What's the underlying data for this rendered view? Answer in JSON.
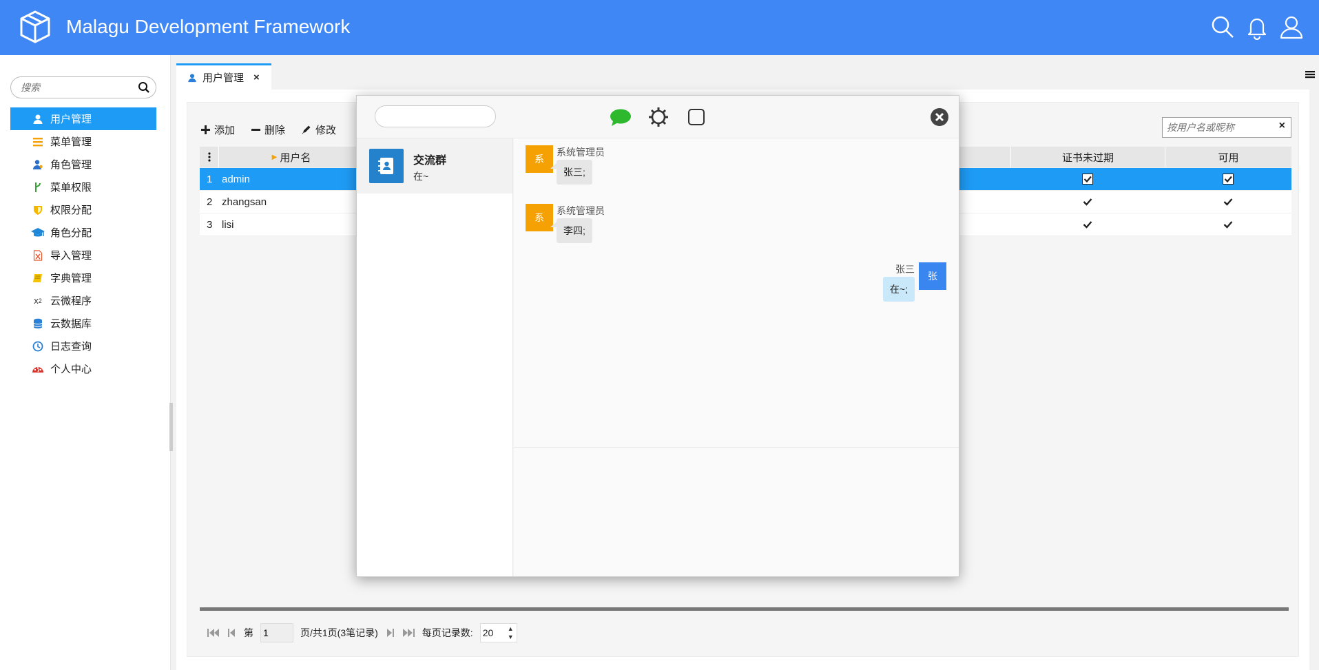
{
  "header": {
    "title": "Malagu Development Framework",
    "icons": [
      "box-logo-icon",
      "search-icon",
      "bell-icon",
      "user-icon"
    ],
    "color": "#3f87f5"
  },
  "sidebar": {
    "search_placeholder": "搜索",
    "items": [
      {
        "label": "用户管理",
        "icon": "user-icon",
        "active": true
      },
      {
        "label": "菜单管理",
        "icon": "list-icon"
      },
      {
        "label": "角色管理",
        "icon": "role-icon"
      },
      {
        "label": "菜单权限",
        "icon": "branch-icon"
      },
      {
        "label": "权限分配",
        "icon": "shield-icon"
      },
      {
        "label": "角色分配",
        "icon": "graduation-cap-icon"
      },
      {
        "label": "导入管理",
        "icon": "excel-file-icon"
      },
      {
        "label": "字典管理",
        "icon": "book-icon"
      },
      {
        "label": "云微程序",
        "icon": "superscript-icon"
      },
      {
        "label": "云数据库",
        "icon": "database-icon"
      },
      {
        "label": "日志查询",
        "icon": "clock-icon"
      },
      {
        "label": "个人中心",
        "icon": "dashboard-icon"
      }
    ],
    "accent": "#1e9bf5"
  },
  "tabs": [
    {
      "label": "用户管理",
      "close": "×"
    }
  ],
  "toolbar": {
    "add": "添加",
    "delete": "删除",
    "edit": "修改"
  },
  "user_search": {
    "placeholder": "按用户名或昵称",
    "clear": "×"
  },
  "grid": {
    "columns": [
      "用户名",
      "证书未过期",
      "可用"
    ],
    "rows": [
      {
        "index": "1",
        "username": "admin",
        "cert_valid": true,
        "enabled": true
      },
      {
        "index": "2",
        "username": "zhangsan",
        "cert_valid": true,
        "enabled": true
      },
      {
        "index": "3",
        "username": "lisi",
        "cert_valid": true,
        "enabled": true
      }
    ]
  },
  "pager": {
    "page_prefix": "第",
    "page": "1",
    "page_suffix": "页/共1页(3笔记录)",
    "page_size_label": "每页记录数:",
    "page_size": "20"
  },
  "chat": {
    "search_value": "",
    "contact": {
      "name": "交流群",
      "last": "在~"
    },
    "messages": [
      {
        "from": "系统管理员",
        "avatar": "系",
        "text": "张三;",
        "mine": false
      },
      {
        "from": "系统管理员",
        "avatar": "系",
        "text": "李四;",
        "mine": false
      },
      {
        "from": "张三",
        "avatar": "张",
        "text": "在~;",
        "mine": true
      }
    ],
    "colors": {
      "system_avatar": "#f5a103",
      "my_avatar": "#3a86f0",
      "my_bubble": "#c9e8fa"
    }
  }
}
